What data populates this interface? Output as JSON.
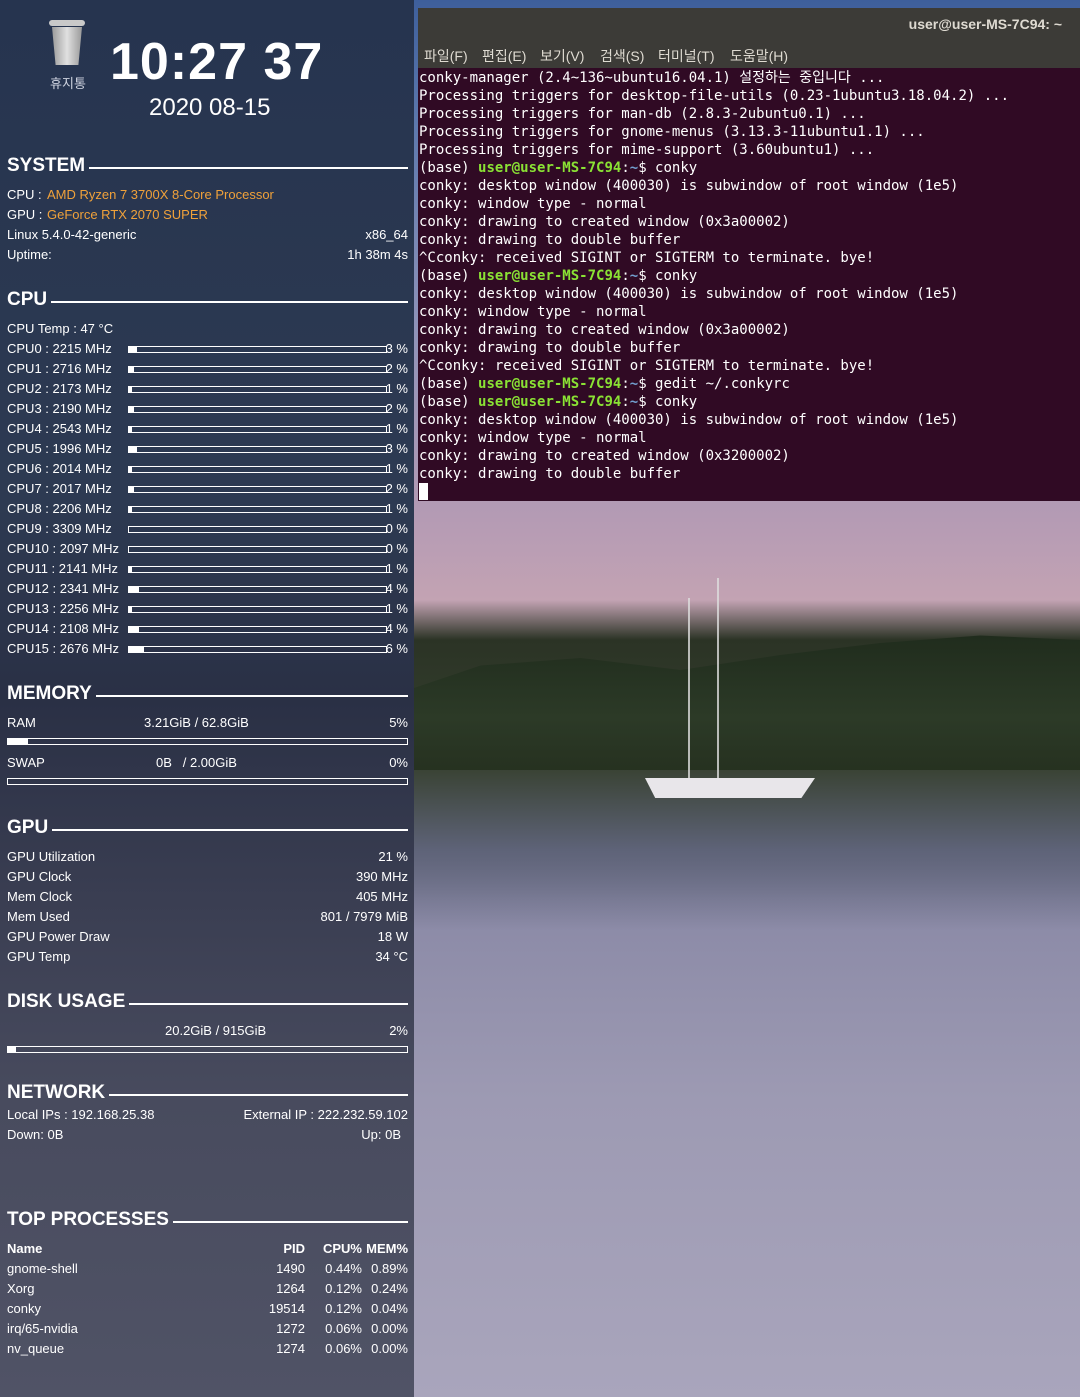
{
  "desktop": {
    "trash_label": "휴지통"
  },
  "conky": {
    "clock": "10:27 37",
    "date": "2020 08-15",
    "system": {
      "heading": "SYSTEM",
      "cpu_label": "CPU :",
      "cpu_value": "AMD Ryzen 7 3700X 8-Core Processor",
      "gpu_label": "GPU :",
      "gpu_value": "GeForce RTX 2070 SUPER",
      "kernel": "Linux 5.4.0-42-generic",
      "arch": "x86_64",
      "uptime_label": "Uptime:",
      "uptime_value": "1h 38m 4s",
      "accent_color": "#f0a13a"
    },
    "cpu": {
      "heading": "CPU",
      "temp": "CPU Temp : 47 °C",
      "cores": [
        {
          "label": "CPU0 :  2215 MHz",
          "pct": "3 %",
          "level": 3
        },
        {
          "label": "CPU1 :  2716 MHz",
          "pct": "2 %",
          "level": 2
        },
        {
          "label": "CPU2 :  2173 MHz",
          "pct": "1 %",
          "level": 1
        },
        {
          "label": "CPU3 :  2190 MHz",
          "pct": "2 %",
          "level": 2
        },
        {
          "label": "CPU4 :  2543 MHz",
          "pct": "1 %",
          "level": 1
        },
        {
          "label": "CPU5 :  1996 MHz",
          "pct": "3 %",
          "level": 3
        },
        {
          "label": "CPU6 :  2014 MHz",
          "pct": "1 %",
          "level": 1
        },
        {
          "label": "CPU7 :  2017 MHz",
          "pct": "2 %",
          "level": 2
        },
        {
          "label": "CPU8 :  2206 MHz",
          "pct": "1 %",
          "level": 1
        },
        {
          "label": "CPU9 :  3309 MHz",
          "pct": "0 %",
          "level": 0
        },
        {
          "label": "CPU10 : 2097 MHz",
          "pct": "0 %",
          "level": 0
        },
        {
          "label": "CPU11 : 2141 MHz",
          "pct": "1 %",
          "level": 1
        },
        {
          "label": "CPU12 : 2341 MHz",
          "pct": "4 %",
          "level": 4
        },
        {
          "label": "CPU13 : 2256 MHz",
          "pct": "1 %",
          "level": 1
        },
        {
          "label": "CPU14 : 2108 MHz",
          "pct": "4 %",
          "level": 4
        },
        {
          "label": "CPU15 : 2676 MHz",
          "pct": "6 %",
          "level": 6
        }
      ]
    },
    "memory": {
      "heading": "MEMORY",
      "ram_label": "RAM",
      "ram_value": "3.21GiB / 62.8GiB",
      "ram_pct": "5%",
      "ram_level": 5,
      "swap_label": "SWAP",
      "swap_value": "0B   / 2.00GiB",
      "swap_pct": "0%",
      "swap_level": 0
    },
    "gpu": {
      "heading": "GPU",
      "rows": [
        {
          "label": "GPU Utilization",
          "value": "21 %"
        },
        {
          "label": "GPU Clock",
          "value": "390 MHz"
        },
        {
          "label": "Mem Clock",
          "value": "405 MHz"
        },
        {
          "label": "Mem Used",
          "value": "801 / 7979 MiB"
        },
        {
          "label": "GPU Power Draw",
          "value": "18 W"
        },
        {
          "label": "GPU Temp",
          "value": "34 °C"
        }
      ]
    },
    "disk": {
      "heading": "DISK USAGE",
      "value": "20.2GiB / 915GiB",
      "pct": "2%",
      "level": 2
    },
    "network": {
      "heading": "NETWORK",
      "local_ip": "Local IPs : 192.168.25.38",
      "external_ip": "External IP : 222.232.59.102",
      "down": "Down: 0B",
      "up": "Up: 0B"
    },
    "processes": {
      "heading": "TOP PROCESSES",
      "columns": [
        "Name",
        "PID",
        "CPU%",
        "MEM%"
      ],
      "rows": [
        {
          "name": "gnome-shell",
          "pid": "1490",
          "cpu": "0.44%",
          "mem": "0.89%"
        },
        {
          "name": "Xorg",
          "pid": "1264",
          "cpu": "0.12%",
          "mem": "0.24%"
        },
        {
          "name": "conky",
          "pid": "19514",
          "cpu": "0.12%",
          "mem": "0.04%"
        },
        {
          "name": "irq/65-nvidia",
          "pid": "1272",
          "cpu": "0.06%",
          "mem": "0.00%"
        },
        {
          "name": "nv_queue",
          "pid": "1274",
          "cpu": "0.06%",
          "mem": "0.00%"
        }
      ]
    }
  },
  "terminal": {
    "title": "user@user-MS-7C94: ~",
    "menu": [
      "파일(F)",
      "편집(E)",
      "보기(V)",
      "검색(S)",
      "터미널(T)",
      "도움말(H)"
    ],
    "background_color": "#300a24",
    "prompt_color": "#8ae234",
    "lines": [
      {
        "text": "conky-manager (2.4~136~ubuntu16.04.1) 설정하는 중입니다 ..."
      },
      {
        "text": "Processing triggers for desktop-file-utils (0.23-1ubuntu3.18.04.2) ..."
      },
      {
        "text": "Processing triggers for man-db (2.8.3-2ubuntu0.1) ..."
      },
      {
        "text": "Processing triggers for gnome-menus (3.13.3-11ubuntu1.1) ..."
      },
      {
        "text": "Processing triggers for mime-support (3.60ubuntu1) ..."
      },
      {
        "pre": "(base) ",
        "user": "user@user-MS-7C94",
        "colon": ":",
        "path": "~",
        "cmd": "$ conky"
      },
      {
        "text": "conky: desktop window (400030) is subwindow of root window (1e5)"
      },
      {
        "text": "conky: window type - normal"
      },
      {
        "text": "conky: drawing to created window (0x3a00002)"
      },
      {
        "text": "conky: drawing to double buffer"
      },
      {
        "text": "^Cconky: received SIGINT or SIGTERM to terminate. bye!"
      },
      {
        "pre": "(base) ",
        "user": "user@user-MS-7C94",
        "colon": ":",
        "path": "~",
        "cmd": "$ conky"
      },
      {
        "text": "conky: desktop window (400030) is subwindow of root window (1e5)"
      },
      {
        "text": "conky: window type - normal"
      },
      {
        "text": "conky: drawing to created window (0x3a00002)"
      },
      {
        "text": "conky: drawing to double buffer"
      },
      {
        "text": "^Cconky: received SIGINT or SIGTERM to terminate. bye!"
      },
      {
        "pre": "(base) ",
        "user": "user@user-MS-7C94",
        "colon": ":",
        "path": "~",
        "cmd": "$ gedit ~/.conkyrc"
      },
      {
        "pre": "(base) ",
        "user": "user@user-MS-7C94",
        "colon": ":",
        "path": "~",
        "cmd": "$ conky"
      },
      {
        "text": "conky: desktop window (400030) is subwindow of root window (1e5)"
      },
      {
        "text": "conky: window type - normal"
      },
      {
        "text": "conky: drawing to created window (0x3200002)"
      },
      {
        "text": "conky: drawing to double buffer"
      }
    ]
  }
}
